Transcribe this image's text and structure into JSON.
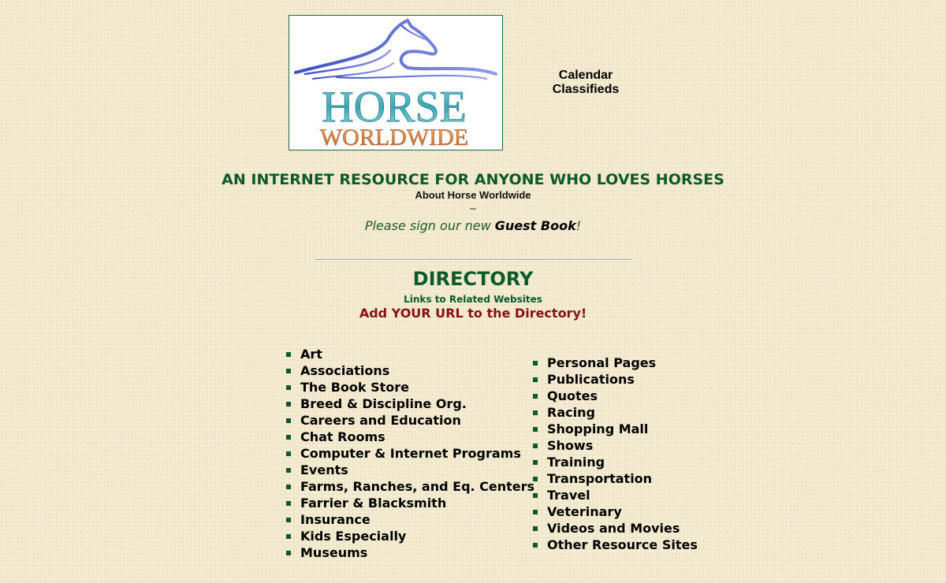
{
  "logo": {
    "line1": "HORSE",
    "line2": "WORLDWIDE"
  },
  "top_links": [
    "Calendar",
    "Classifieds"
  ],
  "tagline": "AN INTERNET RESOURCE FOR ANYONE WHO LOVES HORSES",
  "about_link": "About Horse Worldwide",
  "separator": "~",
  "guest": {
    "prefix": "Please sign our new ",
    "link": "Guest Book",
    "suffix": "!"
  },
  "directory": {
    "title": "DIRECTORY",
    "subtitle": "Links to Related Websites",
    "add_url": "Add YOUR URL to the Directory!",
    "column1": [
      "Art",
      "Associations",
      "The Book Store",
      "Breed & Discipline Org.",
      "Careers and Education",
      "Chat Rooms",
      "Computer & Internet Programs",
      "Events",
      "Farms, Ranches, and Eq. Centers",
      "Farrier & Blacksmith",
      "Insurance",
      "Kids Especially",
      "Museums"
    ],
    "column2": [
      "Personal Pages",
      "Publications",
      "Quotes",
      "Racing",
      "Shopping Mall",
      "Shows",
      "Training",
      "Transportation",
      "Travel",
      "Veterinary",
      "Videos and Movies",
      "Other Resource Sites"
    ]
  },
  "colors": {
    "green": "#0b5a2a",
    "red": "#8b1010",
    "background": "#f3ead0"
  }
}
